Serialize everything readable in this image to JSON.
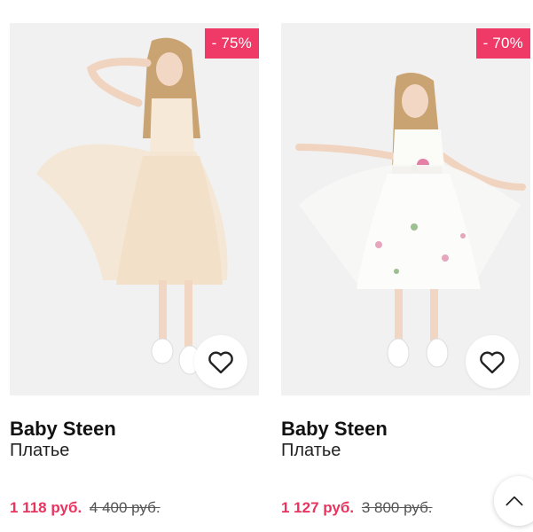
{
  "colors": {
    "accent": "#ef3a68",
    "price_new": "#e8345f",
    "photo_bg": "#f1f1f1"
  },
  "products": [
    {
      "discount": "- 75%",
      "brand": "Baby Steen",
      "type": "Платье",
      "price_new": "1 118 руб.",
      "price_old": "4 400 руб.",
      "favorite_icon": "heart-outline-icon"
    },
    {
      "discount": "- 70%",
      "brand": "Baby Steen",
      "type": "Платье",
      "price_new": "1 127 руб.",
      "price_old": "3 800 руб.",
      "favorite_icon": "heart-outline-icon"
    }
  ],
  "scroll_top_icon": "chevron-up-icon"
}
